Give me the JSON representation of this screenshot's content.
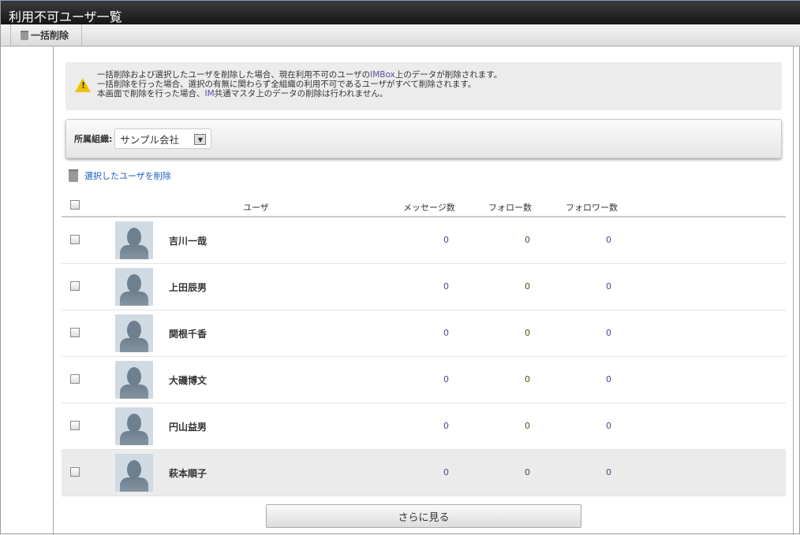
{
  "title": "利用不可ユーザ一覧",
  "toolbar": {
    "bulk_delete": "一括削除"
  },
  "warning": {
    "line1_a": "一括削除および選択したユーザを削除した場合、現在利用不可のユーザの",
    "line1_hl": "IMBox",
    "line1_b": "上のデータが削除されます。",
    "line2": "一括削除を行った場合、選択の有無に関わらず全組織の利用不可であるユーザがすべて削除されます。",
    "line3_a": "本画面で削除を行った場合、",
    "line3_hl": "IM",
    "line3_b": "共通マスタ上のデータの削除は行われません。"
  },
  "filter": {
    "label": "所属組織:",
    "selected": "サンプル会社"
  },
  "delete_selected": "選択したユーザを削除",
  "columns": {
    "user": "ユーザ",
    "messages": "メッセージ数",
    "follows": "フォロー数",
    "followers": "フォロワー数"
  },
  "users": [
    {
      "name": "吉川一哉",
      "messages": "0",
      "follows": "0",
      "followers": "0"
    },
    {
      "name": "上田辰男",
      "messages": "0",
      "follows": "0",
      "followers": "0"
    },
    {
      "name": "関根千香",
      "messages": "0",
      "follows": "0",
      "followers": "0"
    },
    {
      "name": "大磯博文",
      "messages": "0",
      "follows": "0",
      "followers": "0"
    },
    {
      "name": "円山益男",
      "messages": "0",
      "follows": "0",
      "followers": "0"
    },
    {
      "name": "萩本順子",
      "messages": "0",
      "follows": "0",
      "followers": "0"
    }
  ],
  "more_button": "さらに見る"
}
